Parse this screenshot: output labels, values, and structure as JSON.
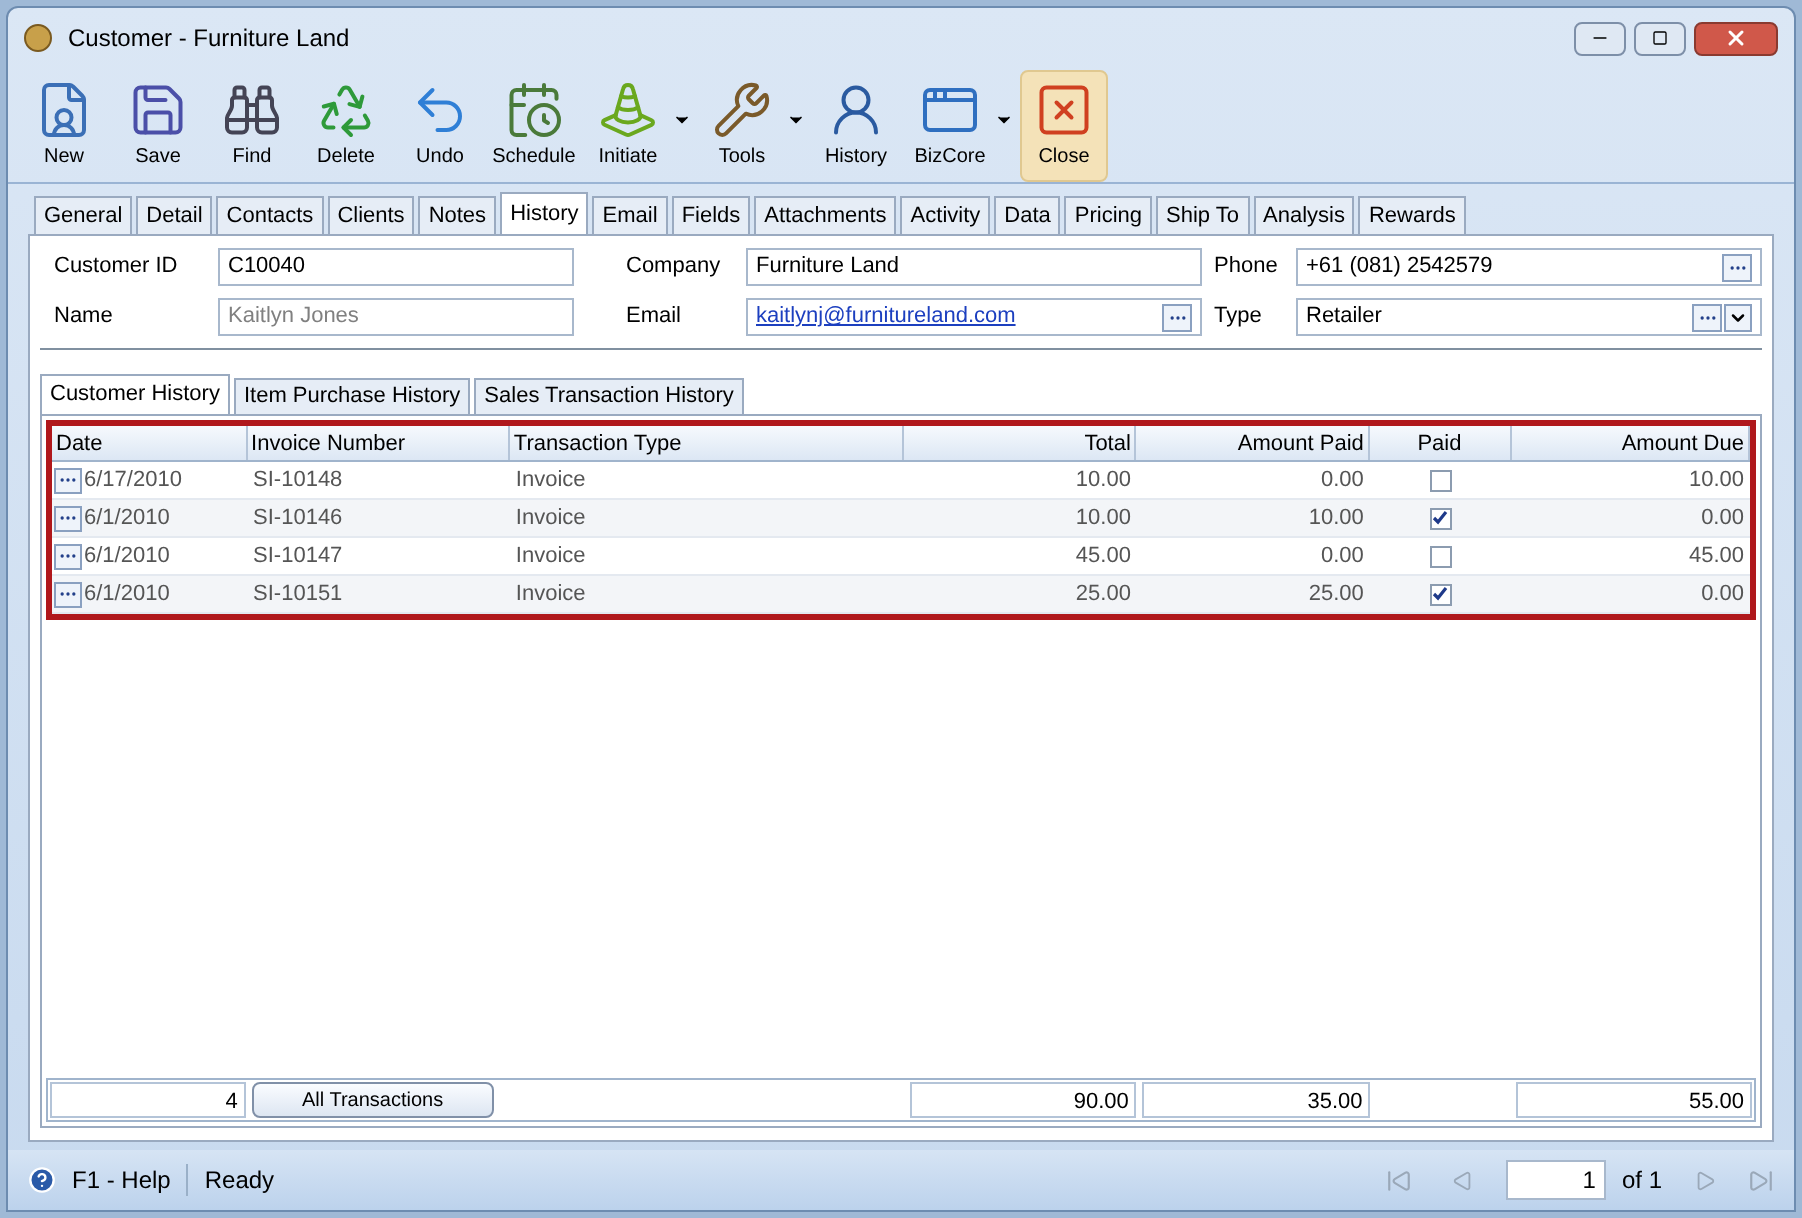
{
  "window": {
    "title": "Customer - Furniture Land"
  },
  "toolbar": [
    {
      "label": "New",
      "kind": "new",
      "has_menu": false,
      "highlighted": false
    },
    {
      "label": "Save",
      "kind": "save",
      "has_menu": false,
      "highlighted": false
    },
    {
      "label": "Find",
      "kind": "find",
      "has_menu": false,
      "highlighted": false
    },
    {
      "label": "Delete",
      "kind": "delete",
      "has_menu": false,
      "highlighted": false
    },
    {
      "label": "Undo",
      "kind": "undo",
      "has_menu": false,
      "highlighted": false
    },
    {
      "label": "Schedule",
      "kind": "schedule",
      "has_menu": false,
      "highlighted": false
    },
    {
      "label": "Initiate",
      "kind": "initiate",
      "has_menu": true,
      "highlighted": false
    },
    {
      "label": "Tools",
      "kind": "tools",
      "has_menu": true,
      "highlighted": false
    },
    {
      "label": "History",
      "kind": "history",
      "has_menu": false,
      "highlighted": false
    },
    {
      "label": "BizCore",
      "kind": "bizcore",
      "has_menu": true,
      "highlighted": false
    },
    {
      "label": "Close",
      "kind": "close",
      "has_menu": false,
      "highlighted": true
    }
  ],
  "tabs": [
    {
      "label": "General",
      "selected": false
    },
    {
      "label": "Detail",
      "selected": false
    },
    {
      "label": "Contacts",
      "selected": false
    },
    {
      "label": "Clients",
      "selected": false
    },
    {
      "label": "Notes",
      "selected": false
    },
    {
      "label": "History",
      "selected": true
    },
    {
      "label": "Email",
      "selected": false
    },
    {
      "label": "Fields",
      "selected": false
    },
    {
      "label": "Attachments",
      "selected": false
    },
    {
      "label": "Activity",
      "selected": false
    },
    {
      "label": "Data",
      "selected": false
    },
    {
      "label": "Pricing",
      "selected": false
    },
    {
      "label": "Ship To",
      "selected": false
    },
    {
      "label": "Analysis",
      "selected": false
    },
    {
      "label": "Rewards",
      "selected": false
    }
  ],
  "fields": [
    {
      "label": "Customer ID",
      "value": "C10040",
      "kind": "text",
      "disabled": false
    },
    {
      "label": "Company",
      "value": "Furniture Land",
      "kind": "text",
      "disabled": false
    },
    {
      "label": "Phone",
      "value": "+61 (081) 2542579",
      "kind": "lookup",
      "disabled": false
    },
    {
      "label": "Name",
      "value": "Kaitlyn Jones",
      "kind": "text",
      "disabled": true
    },
    {
      "label": "Email",
      "value": "kaitlynj@furnitureland.com",
      "kind": "link",
      "disabled": false
    },
    {
      "label": "Type",
      "value": "Retailer",
      "kind": "combo",
      "disabled": false
    }
  ],
  "subtabs": [
    {
      "label": "Customer History",
      "selected": true
    },
    {
      "label": "Item Purchase History",
      "selected": false
    },
    {
      "label": "Sales Transaction History",
      "selected": false
    }
  ],
  "table": {
    "columns": [
      "Date",
      "Invoice Number",
      "Transaction Type",
      "Total",
      "Amount Paid",
      "Paid",
      "Amount Due"
    ],
    "rows": [
      {
        "date": "6/17/2010",
        "invoice": "SI-10148",
        "type": "Invoice",
        "total": "10.00",
        "amount_paid": "0.00",
        "paid": false,
        "amount_due": "10.00"
      },
      {
        "date": "6/1/2010",
        "invoice": "SI-10146",
        "type": "Invoice",
        "total": "10.00",
        "amount_paid": "10.00",
        "paid": true,
        "amount_due": "0.00"
      },
      {
        "date": "6/1/2010",
        "invoice": "SI-10147",
        "type": "Invoice",
        "total": "45.00",
        "amount_paid": "0.00",
        "paid": false,
        "amount_due": "45.00"
      },
      {
        "date": "6/1/2010",
        "invoice": "SI-10151",
        "type": "Invoice",
        "total": "25.00",
        "amount_paid": "25.00",
        "paid": true,
        "amount_due": "0.00"
      }
    ],
    "footer": {
      "count": "4",
      "button": "All Transactions",
      "total": "90.00",
      "amount_paid": "35.00",
      "amount_due": "55.00"
    }
  },
  "status_bar": {
    "help": "F1 - Help",
    "status": "Ready",
    "page": "1",
    "of": "of 1"
  }
}
